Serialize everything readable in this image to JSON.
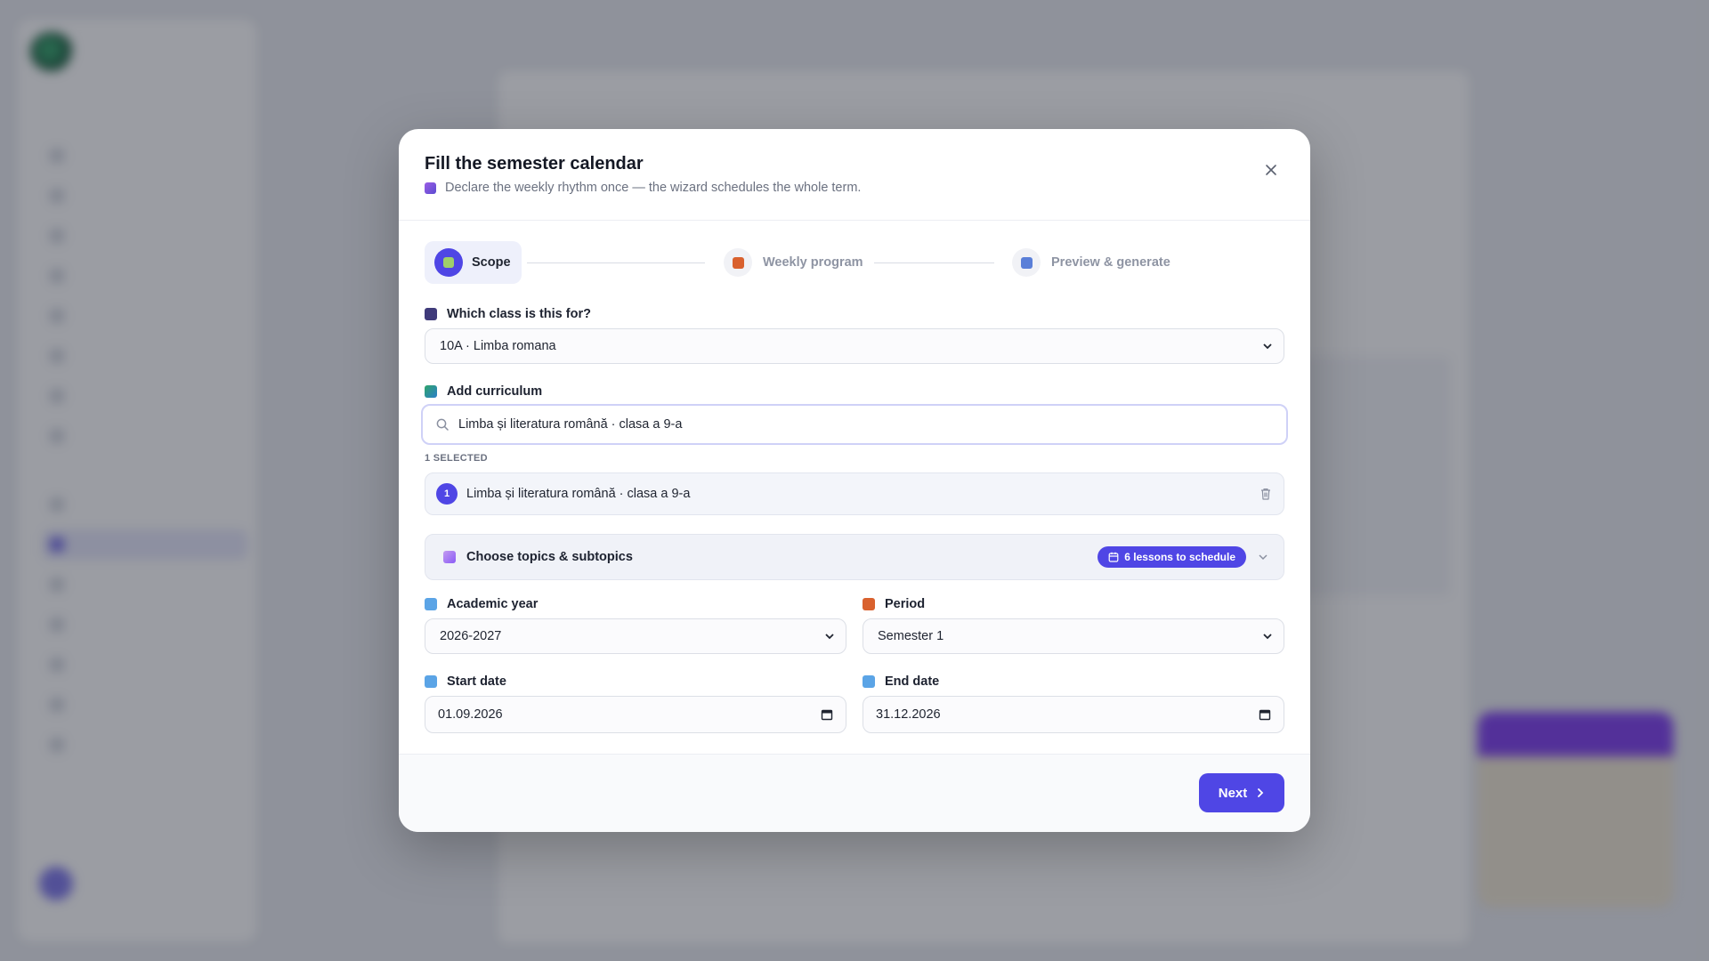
{
  "modal": {
    "title": "Fill the semester calendar",
    "subtitle": "Declare the weekly rhythm once — the wizard schedules the whole term."
  },
  "stepper": {
    "steps": [
      {
        "label": "Scope",
        "state": "active"
      },
      {
        "label": "Weekly program",
        "state": "inactive"
      },
      {
        "label": "Preview & generate",
        "state": "inactive"
      }
    ]
  },
  "form": {
    "class_label": "Which class is this for?",
    "class_value": "10A · Limba romana",
    "curriculum_label": "Add curriculum",
    "curriculum_search_value": "Limba și literatura română · clasa a 9-a",
    "selected_count_label": "1 SELECTED",
    "selected_items": [
      {
        "index": "1",
        "label": "Limba și literatura română · clasa a 9-a"
      }
    ],
    "topics_label": "Choose topics & subtopics",
    "topics_badge": "6 lessons to schedule",
    "academic_year_label": "Academic year",
    "academic_year_value": "2026-2027",
    "period_label": "Period",
    "period_value": "Semester 1",
    "start_date_label": "Start date",
    "start_date_value": "01.09.2026",
    "end_date_label": "End date",
    "end_date_value": "31.12.2026"
  },
  "footer": {
    "next_label": "Next"
  },
  "colors": {
    "accent": "#4f46e5",
    "overlay": "rgba(34,38,50,0.45)"
  }
}
